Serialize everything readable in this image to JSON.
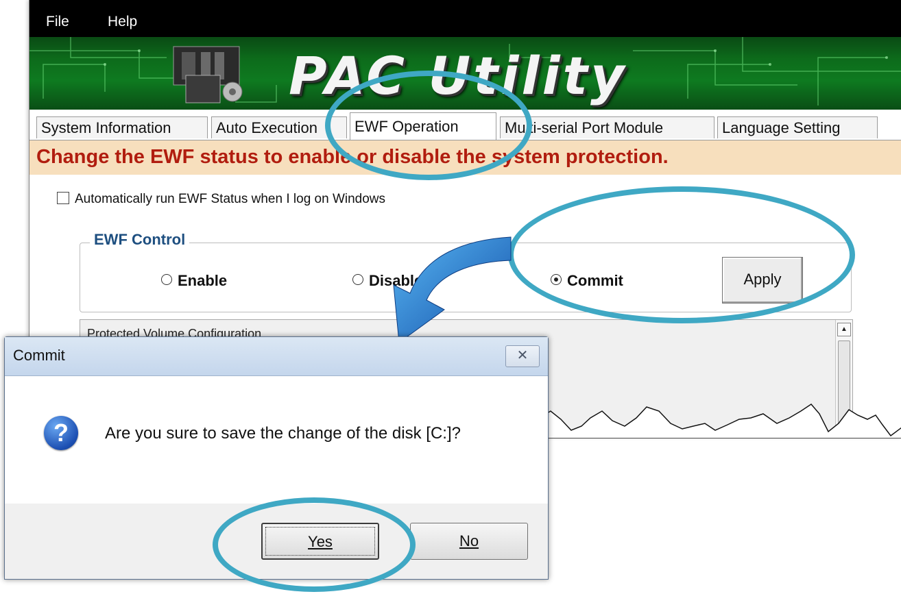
{
  "menu": {
    "file": "File",
    "help": "Help"
  },
  "banner": {
    "title": "PAC Utility"
  },
  "tabs": [
    {
      "label": "System Information"
    },
    {
      "label": "Auto Execution"
    },
    {
      "label": "EWF Operation"
    },
    {
      "label": "Multi-serial Port Module"
    },
    {
      "label": "Language Setting"
    }
  ],
  "hint": "Change the EWF status to enable or disable the system protection.",
  "auto_run_label": "Automatically run EWF Status when I log on Windows",
  "ewf_control": {
    "legend": "EWF Control",
    "options": [
      "Enable",
      "Disable",
      "Commit"
    ],
    "selected": "Commit",
    "apply_label": "Apply"
  },
  "protected_volume_label": "Protected Volume Configuration",
  "dialog": {
    "title": "Commit",
    "close_glyph": "✕",
    "message": "Are you sure to save the change of the disk [C:]?",
    "yes_label": "Yes",
    "no_label": "No"
  },
  "icons": [
    "close-icon",
    "question-icon",
    "scroll-up-icon",
    "curved-arrow-icon"
  ],
  "colors": {
    "highlight": "#3fa8c4",
    "hint_text": "#b11d0f",
    "hint_bg": "#f7dfbd",
    "legend": "#1e4f80"
  }
}
